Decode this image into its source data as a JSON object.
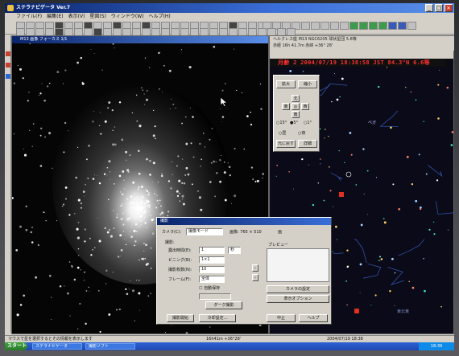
{
  "window": {
    "title": "ステラナビゲータ Ver.7"
  },
  "menu": [
    "ファイル(F)",
    "編集(E)",
    "表示(V)",
    "星図(S)",
    "ウィンドウ(W)",
    "ヘルプ(H)"
  ],
  "image_window": {
    "title": "M13 画像 フォーカス 1/1",
    "cursor": "pointer"
  },
  "sky_window": {
    "info_line1": "ヘルクレス座 M13 NGC6205 球状星団 5.8等",
    "info_line2": "赤経 16h 41.7m 赤緯 +36° 28'",
    "date_line": "月齢 2  2004/07/19  18:38:58 JST  84.3°N  6.6等",
    "controls": {
      "zoom_in": "拡大",
      "zoom_out": "縮小",
      "up": "北",
      "left": "東",
      "center": "◎",
      "right": "西",
      "down": "南",
      "opt1": "15°",
      "opt2": "5°",
      "opt3": "1°",
      "day": "昼",
      "night": "夜",
      "reset": "元に戻す",
      "detail": "詳細"
    },
    "star_label": "ベガ",
    "bottom_label": "東北東"
  },
  "dialog": {
    "title": "撮影",
    "camera_label": "カメラ(C):",
    "camera_value": "撮像モード",
    "size_label": "画像: 765 × 510",
    "size_unit": "画",
    "section_label": "撮影:",
    "exposure_label": "露出時間(E):",
    "exposure_value": "1",
    "exposure_unit": "秒",
    "binning_label": "ビニング(B):",
    "binning_value": "1×1",
    "count_label": "撮影枚数(N):",
    "count_value": "10",
    "interval_label": "フレーム(F):",
    "interval_value": "全体",
    "auto_save_label": "自動保存",
    "preview_label": "プレビュー",
    "dark_button": "ダーク撮影",
    "cooling_button": "冷却設定...",
    "start_button": "撮影開始",
    "setup_button": "カメラの設定",
    "stop_button": "中止",
    "close_button": "閉じる",
    "help_button": "ヘルプ",
    "display_button": "表示オプション"
  },
  "status": {
    "left": "マウスで星を選択するとその情報を表示します",
    "mid": "16h41m  +36°28'",
    "right": "2004/07/19 18:38"
  },
  "taskbar": {
    "start": "スタート",
    "tasks": [
      "ステラナビゲータ",
      "撮影ソフト"
    ],
    "clock": "18:39"
  }
}
